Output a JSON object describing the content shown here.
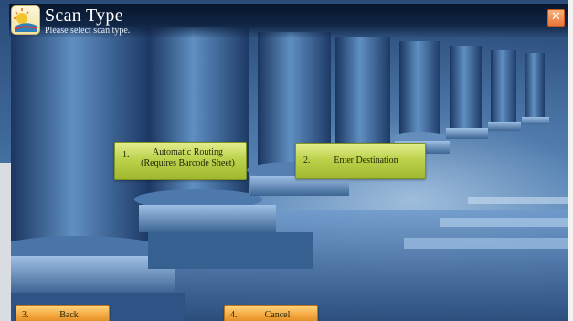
{
  "window": {
    "title": "Scan Type",
    "subtitle": "Please select scan type.",
    "close_label": "✕"
  },
  "options": [
    {
      "number": "1.",
      "label_line1": "Automatic Routing",
      "label_line2": "(Requires Barcode Sheet)"
    },
    {
      "number": "2.",
      "label": "Enter Destination"
    }
  ],
  "footer": {
    "back": {
      "number": "3.",
      "label": "Back"
    },
    "cancel": {
      "number": "4.",
      "label": "Cancel"
    }
  },
  "colors": {
    "option_button": "#bdd24c",
    "footer_button": "#f3a43a",
    "close_button": "#e8753a",
    "title_bar": "#0c1e3a"
  },
  "icons": [
    "app-logo-icon",
    "close-icon"
  ]
}
